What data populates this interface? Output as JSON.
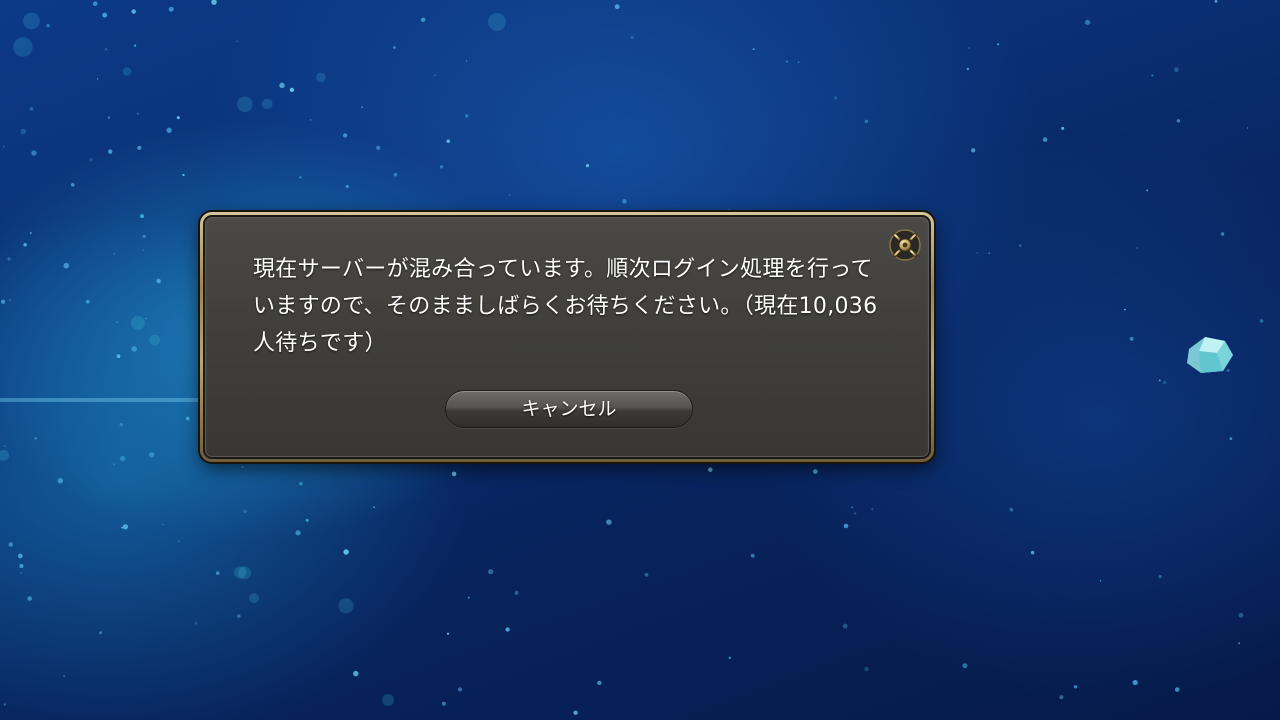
{
  "dialog": {
    "message": "現在サーバーが混み合っています。順次ログイン処理を行っていますので、そのまましばらくお待ちください。（現在10,036人待ちです）",
    "cancel_label": "キャンセル"
  },
  "icons": {
    "close": "close-icon",
    "crystal": "crystal-icon"
  },
  "colors": {
    "background": "#0a2f74",
    "dialog_fill": "#403f3c",
    "dialog_border": "#b8a57a",
    "text": "#ffffff"
  }
}
